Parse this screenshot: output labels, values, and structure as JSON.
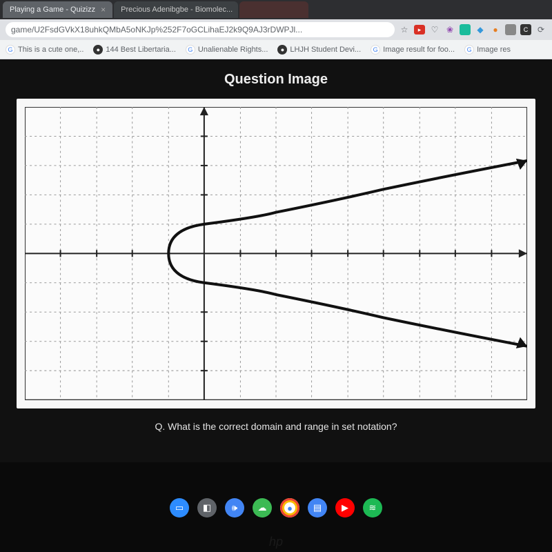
{
  "browser": {
    "tabs": [
      {
        "title": "Playing a Game - Quizizz",
        "active": true
      },
      {
        "title": "Precious Adenibgbe - Biomolec...",
        "active": false
      },
      {
        "title": "",
        "active": false
      }
    ],
    "url": "game/U2FsdGVkX18uhkQMbA5oNKJp%252F7oGCLihaEJ2k9Q9AJ3rDWPJl...",
    "extension_icons": [
      "star-icon",
      "red-badge-icon",
      "outline-heart-icon",
      "purple-puzzle-icon",
      "teal-square-icon",
      "blue-diamond-icon",
      "orange-dot-icon",
      "grey-square-icon",
      "dark-square-icon",
      "menu-icon"
    ],
    "bookmarks": [
      {
        "icon": "G",
        "label": "This is a cute one,.."
      },
      {
        "icon": "●",
        "label": "144 Best Libertaria..."
      },
      {
        "icon": "G",
        "label": "Unalienable Rights..."
      },
      {
        "icon": "●",
        "label": "LHJH Student Devi..."
      },
      {
        "icon": "G",
        "label": "Image result for foo..."
      },
      {
        "icon": "G",
        "label": "Image res"
      }
    ]
  },
  "content": {
    "title": "Question Image",
    "question_prefix": "Q.",
    "question_text": "What is the correct domain and range in set notation?"
  },
  "chart_data": {
    "type": "line",
    "description": "Sideways parabola opening to the right (x = y^2 shape) with vertex near (-1,0); arrows on both branches toward +x.",
    "x_range": [
      -5,
      9
    ],
    "y_range": [
      -5,
      5
    ],
    "x_ticks": [
      -5,
      -4,
      -3,
      -2,
      -1,
      0,
      1,
      2,
      3,
      4,
      5,
      6,
      7,
      8,
      9
    ],
    "y_ticks": [
      -5,
      -4,
      -3,
      -2,
      -1,
      0,
      1,
      2,
      3,
      4,
      5
    ],
    "grid": true,
    "series": [
      {
        "name": "upper branch",
        "x": [
          -1,
          -0.75,
          0,
          1,
          2,
          3,
          4,
          5,
          6,
          7,
          8,
          9
        ],
        "y": [
          0,
          0.5,
          1,
          1.41,
          1.73,
          2,
          2.24,
          2.45,
          2.65,
          2.83,
          3,
          3.16
        ]
      },
      {
        "name": "lower branch",
        "x": [
          -1,
          -0.75,
          0,
          1,
          2,
          3,
          4,
          5,
          6,
          7,
          8,
          9
        ],
        "y": [
          0,
          -0.5,
          -1,
          -1.41,
          -1.73,
          -2,
          -2.24,
          -2.45,
          -2.65,
          -2.83,
          -3,
          -3.16
        ]
      }
    ],
    "vertex": {
      "x": -1,
      "y": 0
    }
  },
  "dock": {
    "icons": [
      {
        "name": "zoom-icon",
        "bg": "#2d8cff",
        "glyph": "▭"
      },
      {
        "name": "app-grey-icon",
        "bg": "#5f6368",
        "glyph": "◧"
      },
      {
        "name": "sound-icon",
        "bg": "#4285f4",
        "glyph": "🔊"
      },
      {
        "name": "cloud-icon",
        "bg": "#34a853",
        "glyph": "☁"
      },
      {
        "name": "chrome-icon",
        "bg": "#ffffff",
        "glyph": "◉"
      },
      {
        "name": "docs-icon",
        "bg": "#4285f4",
        "glyph": "▤"
      },
      {
        "name": "youtube-icon",
        "bg": "#ff0000",
        "glyph": "▶"
      },
      {
        "name": "spotify-icon",
        "bg": "#1db954",
        "glyph": "≋"
      }
    ]
  },
  "logo": "hp"
}
